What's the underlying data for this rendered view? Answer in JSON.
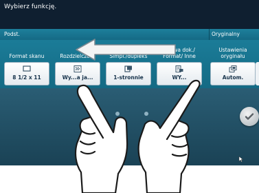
{
  "screen": {
    "prompt": "Wybierz funkcję.",
    "tabs": {
      "left": "Podst.",
      "right": "Oryginalny"
    },
    "functions": [
      {
        "title": "Format skanu",
        "value": "8 1/2 x 11",
        "icon": "paper-size-icon"
      },
      {
        "title": "Rozdzielczość",
        "value": "Wysoka jakość",
        "value_visible": "Wy...a ja...",
        "icon": "resolution-grid-icon"
      },
      {
        "title": "Simpl./dupleks",
        "value": "1-stronnie",
        "icon": "single-sided-icon"
      },
      {
        "title": "Nazwa dok./ Format/ Inne",
        "value": "WY...",
        "icon": "document-name-icon"
      },
      {
        "title": "Ustawienia oryginału",
        "value": "Autom.",
        "icon": "original-settings-icon"
      }
    ]
  },
  "gesture": {
    "type": "two-finger-swipe",
    "direction": "left"
  },
  "colors": {
    "screen_background": "#0f1f30",
    "tab_bar": "#1a7893",
    "panel": "#1b7c98",
    "button_face": "#eef2f5",
    "value_text": "#16324a"
  }
}
